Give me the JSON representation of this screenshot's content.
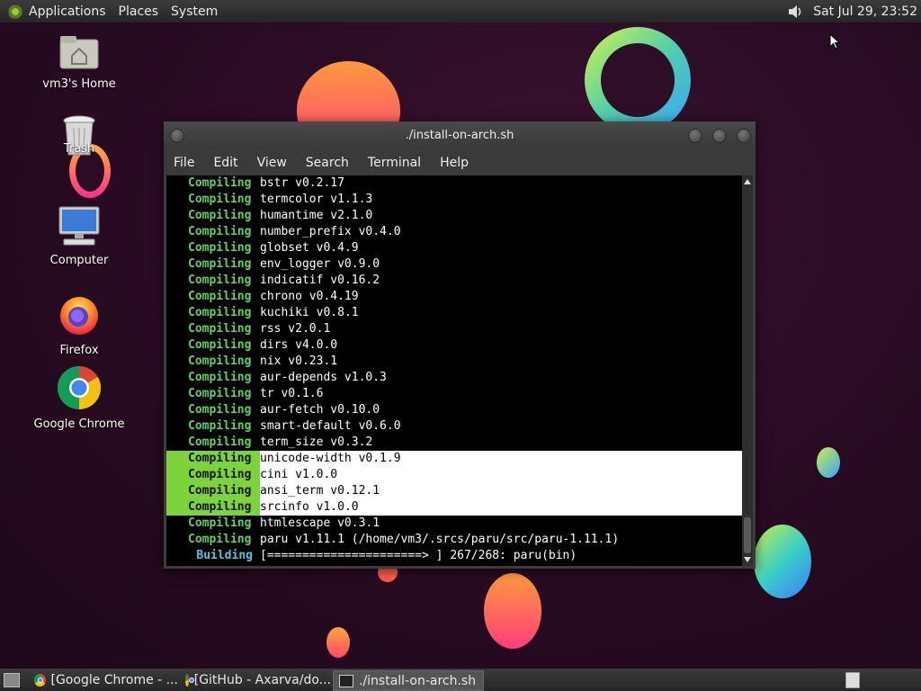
{
  "top_panel": {
    "menus": [
      "Applications",
      "Places",
      "System"
    ],
    "clock": "Sat Jul 29, 23:52"
  },
  "desktop_icons": [
    {
      "label": "vm3's Home",
      "icon": "home-folder-icon"
    },
    {
      "label": "Trash",
      "icon": "trash-icon"
    },
    {
      "label": "Computer",
      "icon": "computer-icon"
    },
    {
      "label": "Firefox",
      "icon": "firefox-icon"
    },
    {
      "label": "Google Chrome",
      "icon": "chrome-icon"
    }
  ],
  "window": {
    "title": "./install-on-arch.sh",
    "menu": [
      "File",
      "Edit",
      "View",
      "Search",
      "Terminal",
      "Help"
    ],
    "lines": [
      {
        "kw": "Compiling",
        "text": "bstr v0.2.17"
      },
      {
        "kw": "Compiling",
        "text": "termcolor v1.1.3"
      },
      {
        "kw": "Compiling",
        "text": "humantime v2.1.0"
      },
      {
        "kw": "Compiling",
        "text": "number_prefix v0.4.0"
      },
      {
        "kw": "Compiling",
        "text": "globset v0.4.9"
      },
      {
        "kw": "Compiling",
        "text": "env_logger v0.9.0"
      },
      {
        "kw": "Compiling",
        "text": "indicatif v0.16.2"
      },
      {
        "kw": "Compiling",
        "text": "chrono v0.4.19"
      },
      {
        "kw": "Compiling",
        "text": "kuchiki v0.8.1"
      },
      {
        "kw": "Compiling",
        "text": "rss v2.0.1"
      },
      {
        "kw": "Compiling",
        "text": "dirs v4.0.0"
      },
      {
        "kw": "Compiling",
        "text": "nix v0.23.1"
      },
      {
        "kw": "Compiling",
        "text": "aur-depends v1.0.3"
      },
      {
        "kw": "Compiling",
        "text": "tr v0.1.6"
      },
      {
        "kw": "Compiling",
        "text": "aur-fetch v0.10.0"
      },
      {
        "kw": "Compiling",
        "text": "smart-default v0.6.0"
      },
      {
        "kw": "Compiling",
        "text": "term_size v0.3.2"
      },
      {
        "kw": "Compiling",
        "text": "unicode-width v0.1.9"
      },
      {
        "kw": "Compiling",
        "text": "cini v1.0.0"
      },
      {
        "kw": "Compiling",
        "text": "ansi_term v0.12.1"
      },
      {
        "kw": "Compiling",
        "text": "srcinfo v1.0.0"
      },
      {
        "kw": "Compiling",
        "text": "htmlescape v0.3.1"
      },
      {
        "kw": "Compiling",
        "text": "paru v1.11.1 (/home/vm3/.srcs/paru/src/paru-1.11.1)"
      },
      {
        "kw": "Building",
        "text": "[======================> ] 267/268: paru(bin)"
      }
    ]
  },
  "taskbar": {
    "tasks": [
      {
        "label": "[Google Chrome - ...",
        "icon": "chrome-icon"
      },
      {
        "label": "[GitHub - Axarva/do...",
        "icon": "chrome-icon"
      },
      {
        "label": "./install-on-arch.sh",
        "icon": "terminal-icon"
      }
    ]
  },
  "colors": {
    "compiling": "#5fd35f",
    "building": "#4fc8e0",
    "highlight_left": "#7dd33a"
  }
}
